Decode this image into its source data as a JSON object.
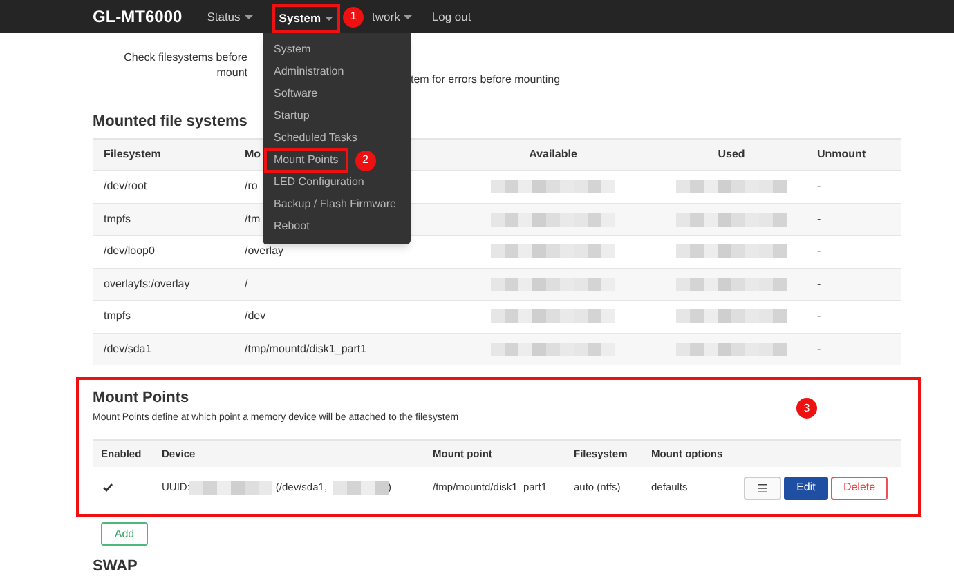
{
  "navbar": {
    "brand": "GL-MT6000",
    "items": [
      {
        "label": "Status",
        "dropdown": true,
        "selected": false
      },
      {
        "label": "System",
        "dropdown": true,
        "selected": true,
        "annotation": "1"
      },
      {
        "label": "twork",
        "dropdown": true,
        "selected": false
      },
      {
        "label": "Log out",
        "dropdown": false,
        "selected": false
      }
    ]
  },
  "system_menu": {
    "items": [
      {
        "label": "System"
      },
      {
        "label": "Administration"
      },
      {
        "label": "Software"
      },
      {
        "label": "Startup"
      },
      {
        "label": "Scheduled Tasks"
      },
      {
        "label": "Mount Points",
        "annotation": "2"
      },
      {
        "label": "LED Configuration"
      },
      {
        "label": "Backup / Flash Firmware"
      },
      {
        "label": "Reboot"
      }
    ]
  },
  "option": {
    "label": "Check filesystems before mount",
    "description": "tem for errors before mounting"
  },
  "mounted": {
    "title": "Mounted file systems",
    "columns": [
      "Filesystem",
      "Mo",
      "Available",
      "Used",
      "Unmount"
    ],
    "rows": [
      {
        "filesystem": "/dev/root",
        "mount_point": "/ro",
        "unmount": "-"
      },
      {
        "filesystem": "tmpfs",
        "mount_point": "/tm",
        "unmount": "-"
      },
      {
        "filesystem": "/dev/loop0",
        "mount_point": "/overlay",
        "unmount": "-"
      },
      {
        "filesystem": "overlayfs:/overlay",
        "mount_point": "/",
        "unmount": "-"
      },
      {
        "filesystem": "tmpfs",
        "mount_point": "/dev",
        "unmount": "-"
      },
      {
        "filesystem": "/dev/sda1",
        "mount_point": "/tmp/mountd/disk1_part1",
        "unmount": "-"
      }
    ]
  },
  "mount_points": {
    "title": "Mount Points",
    "annotation": "3",
    "description": "Mount Points define at which point a memory device will be attached to the filesystem",
    "columns": [
      "Enabled",
      "Device",
      "Mount point",
      "Filesystem",
      "Mount options"
    ],
    "rows": [
      {
        "enabled": true,
        "device_prefix": "UUID:",
        "device_middle": "(/dev/sda1,",
        "device_suffix": ")",
        "mount_point": "/tmp/mountd/disk1_part1",
        "filesystem": "auto (ntfs)",
        "options": "defaults",
        "edit": "Edit",
        "delete": "Delete"
      }
    ]
  },
  "add_button": "Add",
  "swap_title": "SWAP"
}
